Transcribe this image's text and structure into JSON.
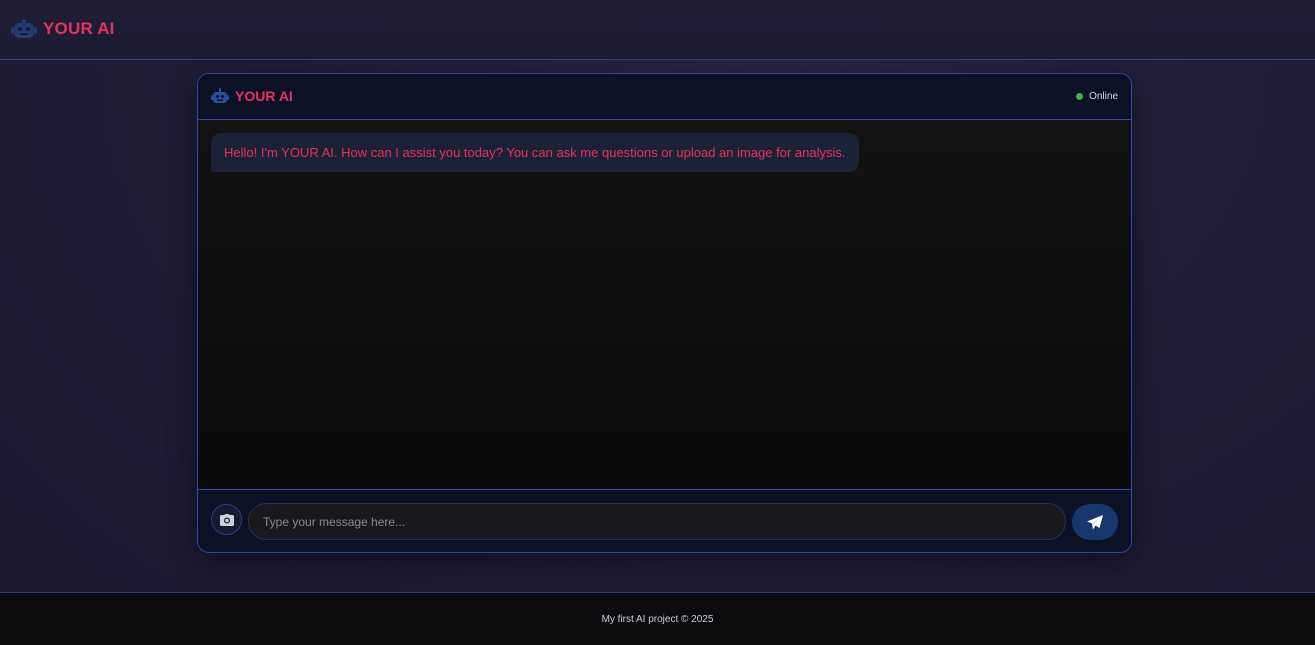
{
  "nav": {
    "brand_icon": "robot-icon",
    "brand_name": "YOUR AI"
  },
  "chat": {
    "header": {
      "icon": "robot-icon",
      "title": "YOUR AI",
      "status": "Online",
      "status_color": "#3fb24b"
    },
    "messages": [
      {
        "sender": "bot",
        "text": "Hello! I'm YOUR AI. How can I assist you today? You can ask me questions or upload an image for analysis."
      }
    ],
    "input": {
      "value": "",
      "placeholder": "Type your message here...",
      "upload_icon": "camera-icon",
      "send_icon": "paper-plane-icon"
    }
  },
  "footer": {
    "text": "My first AI project © 2025"
  },
  "colors": {
    "accent": "#e6335e",
    "border": "#2f4aa8",
    "send_button": "#16386e"
  }
}
